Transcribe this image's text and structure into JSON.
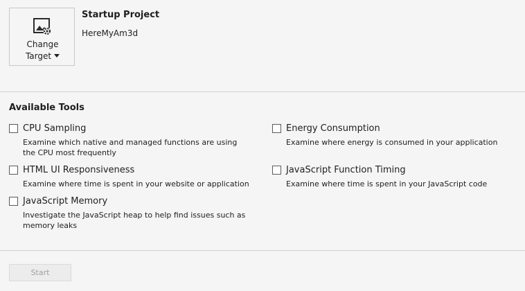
{
  "target": {
    "line1": "Change",
    "line2": "Target",
    "icon": "image-gear-icon"
  },
  "startup": {
    "title": "Startup Project",
    "name": "HereMyAm3d"
  },
  "tools": {
    "heading": "Available Tools",
    "items": [
      {
        "name": "CPU Sampling",
        "description": "Examine which native and managed functions are using the CPU most frequently",
        "checked": false
      },
      {
        "name": "HTML UI Responsiveness",
        "description": "Examine where time is spent in your website or application",
        "checked": false
      },
      {
        "name": "JavaScript Memory",
        "description": "Investigate the JavaScript heap to help find issues such as memory leaks",
        "checked": false
      },
      {
        "name": "Energy Consumption",
        "description": "Examine where energy is consumed in your application",
        "checked": false
      },
      {
        "name": "JavaScript Function Timing",
        "description": "Examine where time is spent in your JavaScript code",
        "checked": false
      }
    ]
  },
  "footer": {
    "start_label": "Start",
    "start_enabled": false
  }
}
